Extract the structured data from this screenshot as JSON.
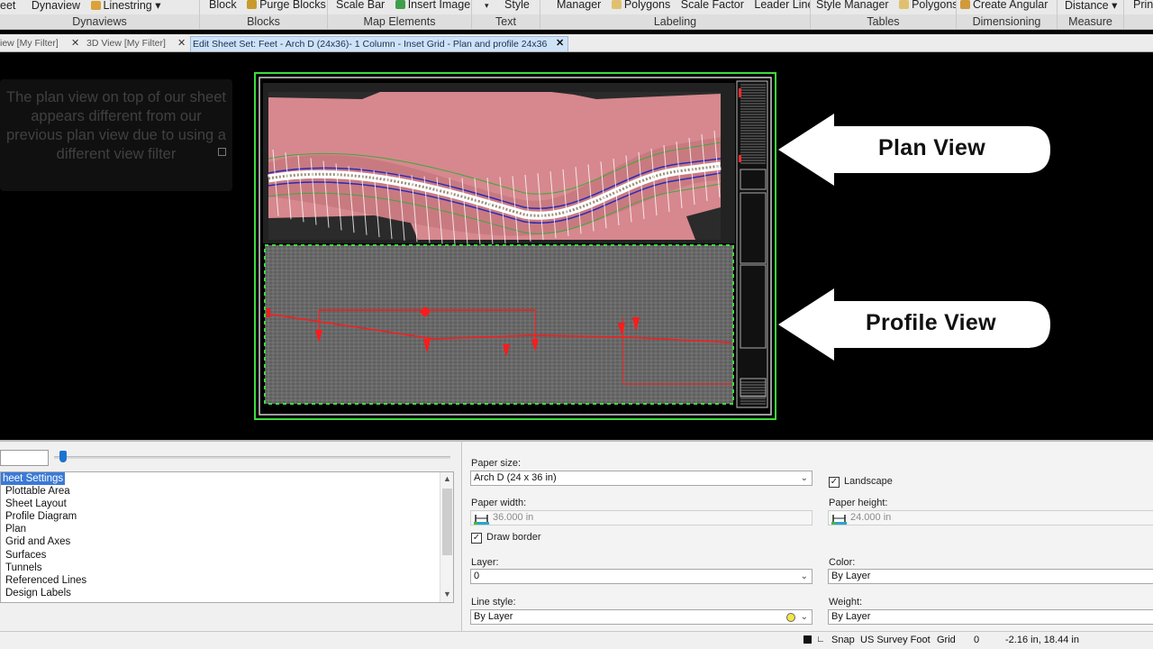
{
  "ribbon": {
    "groups": [
      {
        "title": "Dynaviews",
        "items": [
          "eet",
          "Dynaview",
          "Linestring ▾"
        ]
      },
      {
        "title": "Blocks",
        "items": [
          "Block",
          "Purge Blocks"
        ]
      },
      {
        "title": "Map Elements",
        "items": [
          "Scale Bar",
          "Insert Image"
        ]
      },
      {
        "title": "Text",
        "items": [
          "▾",
          "Style"
        ]
      },
      {
        "title": "Labeling",
        "items": [
          "Manager",
          "Polygons",
          "Scale Factor",
          "Leader Lines"
        ]
      },
      {
        "title": "Tables",
        "items": [
          "Style Manager",
          "Polygons"
        ]
      },
      {
        "title": "Dimensioning",
        "items": [
          "Create Angular"
        ]
      },
      {
        "title": "Measure",
        "items": [
          "Distance ▾"
        ]
      },
      {
        "title": "",
        "items": [
          "Prin"
        ]
      }
    ]
  },
  "tabs": [
    {
      "label": "iew [My Filter]",
      "close": "✕"
    },
    {
      "label": "3D View [My Filter]",
      "close": "✕"
    },
    {
      "label": "Edit Sheet Set: Feet - Arch D (24x36)- 1 Column - Inset Grid - Plan and profile 24x36",
      "close": "✕"
    }
  ],
  "viewport": {
    "caption": "The plan view on top of our sheet appears different from our previous plan view due to using a different view filter",
    "callouts": {
      "plan": "Plan View",
      "profile": "Profile View"
    }
  },
  "tree": {
    "items": [
      "Sheet Settings",
      "Plottable Area",
      "Sheet Layout",
      "Profile Diagram",
      "Plan",
      "Grid and Axes",
      "Surfaces",
      "Tunnels",
      "Referenced Lines",
      "Design Labels"
    ],
    "visible_items": [
      "heet Settings",
      "Plottable Area",
      "Sheet Layout",
      "Profile Diagram",
      "Plan",
      "Grid and Axes",
      "Surfaces",
      "Tunnels",
      "Referenced Lines",
      "Design Labels"
    ],
    "selected_index": 0
  },
  "properties": {
    "paper_size_label": "Paper size:",
    "paper_size_value": "Arch D (24 x 36 in)",
    "landscape_label": "Landscape",
    "landscape_checked": true,
    "paper_width_label": "Paper width:",
    "paper_width_value": "36.000 in",
    "paper_height_label": "Paper height:",
    "paper_height_value": "24.000 in",
    "draw_border_label": "Draw border",
    "draw_border_checked": true,
    "layer_label": "Layer:",
    "layer_value": "0",
    "color_label": "Color:",
    "color_value": "By Layer",
    "line_style_label": "Line style:",
    "line_style_value": "By Layer",
    "weight_label": "Weight:",
    "weight_value": "By Layer"
  },
  "status": {
    "snap": "Snap",
    "units": "US Survey Foot",
    "grid": "Grid",
    "grid_value": "0",
    "coords": "-2.16 in, 18.44 in"
  },
  "colors": {
    "ribbon_bg": "#e9e9e9",
    "active_tab": "#cfe3f7",
    "plan_fill": "#d6888e",
    "profile_grid": "#7a7a7a",
    "profile_red": "#ff1a1a",
    "sheet_border": "#3ddc3d",
    "selection": "#3b7ad6"
  }
}
